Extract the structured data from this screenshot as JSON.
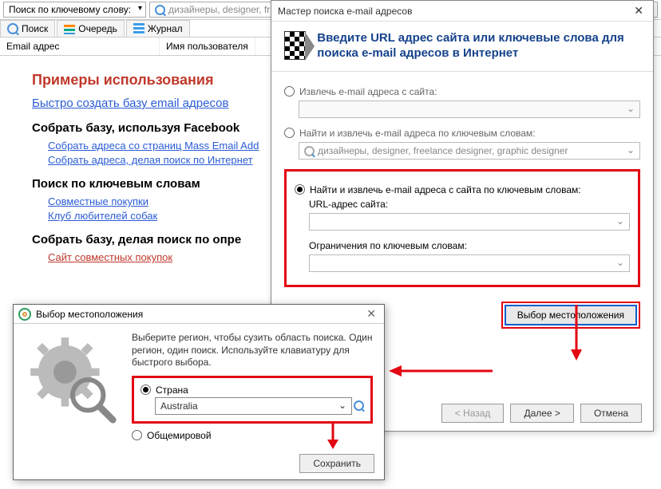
{
  "toolbar": {
    "search_mode": "Поиск по ключевому слову:",
    "query": "дизайнеры, designer, fr"
  },
  "tabs": {
    "search": "Поиск",
    "queue": "Очередь",
    "journal": "Журнал"
  },
  "columns": {
    "email": "Email адрес",
    "user": "Имя пользователя"
  },
  "examples": {
    "title": "Примеры использования",
    "quick": "Быстро создать базу email адресов",
    "fb_title": "Собрать базу, используя Facebook",
    "fb1": "Собрать адреса со страниц Mass Email Add",
    "fb2": "Собрать адреса, делая поиск по Интернет",
    "kw_title": "Поиск по ключевым словам",
    "kw1": "Совместные покупки",
    "kw2": "Клуб любителей собак",
    "sites_title": "Собрать базу, делая поиск по опре",
    "sites1": "Сайт совместных покупок"
  },
  "wizard": {
    "title": "Мастер поиска e-mail адресов",
    "heading": "Введите URL адрес сайта или ключевые слова для поиска e-mail адресов в Интернет",
    "opt1": "Извлечь e-mail адреса с сайта:",
    "opt2": "Найти и извлечь e-mail адреса по ключевым словам:",
    "opt2_value": "дизайнеры, designer, freelance designer, graphic designer",
    "opt3": "Найти и извлечь e-mail адреса с сайта по ключевым словам:",
    "url_label": "URL-адрес сайта:",
    "kw_label": "Ограничения по ключевым словам:",
    "dots": "...",
    "loc_btn": "Выбор местоположения",
    "back": "< Назад",
    "next": "Далее >",
    "cancel": "Отмена"
  },
  "locdlg": {
    "title": "Выбор местоположения",
    "desc": "Выберите регион, чтобы сузить область поиска. Один регион, один поиск. Используйте клавиатуру для быстрого выбора.",
    "opt_country": "Страна",
    "country_value": "Australia",
    "opt_world": "Общемировой",
    "save": "Сохранить"
  }
}
